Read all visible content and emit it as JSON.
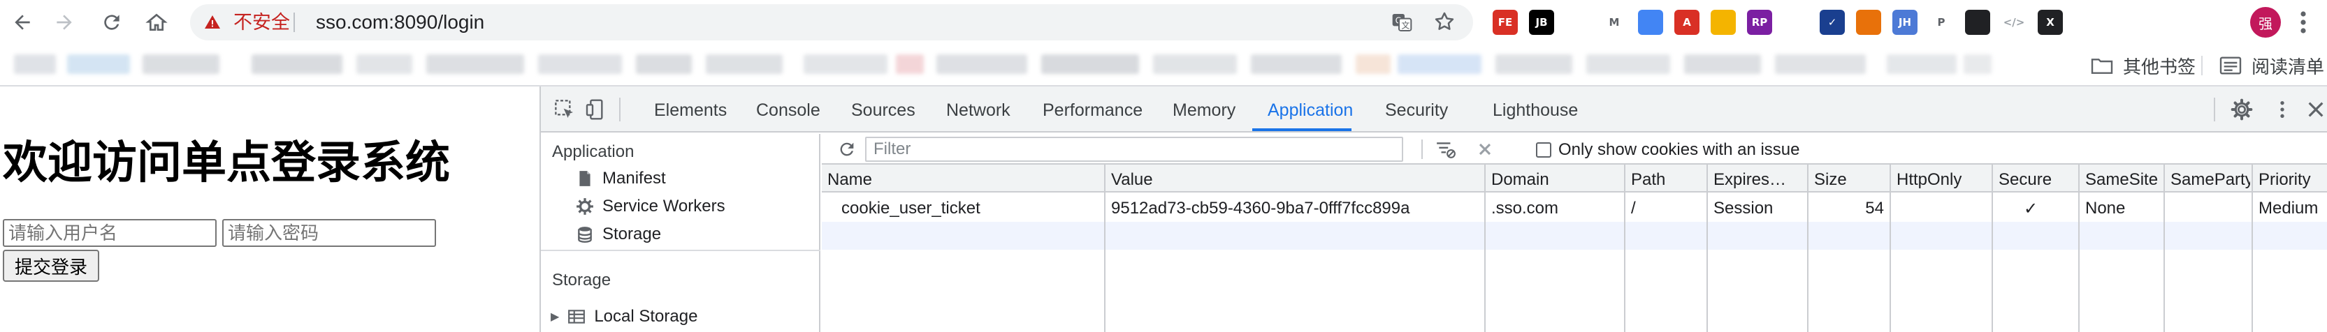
{
  "browser": {
    "security_label": "不安全",
    "url": "sso.com:8090/login",
    "extensions": [
      {
        "name": "fe-helper-icon",
        "text": "FE",
        "color": "#d93025"
      },
      {
        "name": "jetbrains-icon",
        "text": "JB",
        "color": "#000000"
      },
      {
        "name": "vue-devtools-icon",
        "text": "",
        "color": "#5f6368"
      },
      {
        "name": "gmail-checker-icon",
        "text": "M",
        "color": "#5f6368"
      },
      {
        "name": "chrome-color-icon",
        "text": "",
        "color": "#4285f4"
      },
      {
        "name": "pdf-icon",
        "text": "A",
        "color": "#d93025"
      },
      {
        "name": "calendar-icon",
        "text": "",
        "color": "#f4b400"
      },
      {
        "name": "axure-rp-icon",
        "text": "RP",
        "color": "#7b1fa2"
      },
      {
        "name": "wavy-icon",
        "text": "",
        "color": "#3c4043"
      },
      {
        "name": "checkmark-circle-icon",
        "text": "✓",
        "color": "#1a3f8f"
      },
      {
        "name": "tree-icon",
        "text": "",
        "color": "#e8710a"
      },
      {
        "name": "jh-icon",
        "text": "JH",
        "color": "#4d7ad6"
      },
      {
        "name": "p-icon",
        "text": "P",
        "color": "#5f6368"
      },
      {
        "name": "cube-icon",
        "text": "",
        "color": "#202124"
      },
      {
        "name": "code-icon",
        "text": "</>",
        "color": "#9aa0a6"
      },
      {
        "name": "x-icon",
        "text": "X",
        "color": "#202124"
      },
      {
        "name": "puzzle-icon",
        "text": "",
        "color": "#5f6368"
      }
    ],
    "avatar_text": "强"
  },
  "bookmarks": {
    "other_bookmarks": "其他书签",
    "reading_list": "阅读清单"
  },
  "page": {
    "heading": "欢迎访问单点登录系统",
    "username_placeholder": "请输入用户名",
    "password_placeholder": "请输入密码",
    "submit_label": "提交登录"
  },
  "devtools": {
    "tabs": [
      "Elements",
      "Console",
      "Sources",
      "Network",
      "Performance",
      "Memory",
      "Application",
      "Security",
      "Lighthouse"
    ],
    "active_tab": "Application",
    "sidebar": {
      "application_header": "Application",
      "items": [
        "Manifest",
        "Service Workers",
        "Storage"
      ],
      "storage_header": "Storage",
      "storage_items": [
        "Local Storage"
      ]
    },
    "filter_placeholder": "Filter",
    "only_issue_label": "Only show cookies with an issue",
    "columns": [
      "Name",
      "Value",
      "Domain",
      "Path",
      "Expires…",
      "Size",
      "HttpOnly",
      "Secure",
      "SameSite",
      "SameParty",
      "Priority"
    ],
    "cookies": [
      {
        "name": "cookie_user_ticket",
        "value": "9512ad73-cb59-4360-9ba7-0fff7fcc899a",
        "domain": ".sso.com",
        "path": "/",
        "expires": "Session",
        "size": "54",
        "httponly": "",
        "secure": "✓",
        "samesite": "None",
        "sameparty": "",
        "priority": "Medium"
      }
    ]
  }
}
